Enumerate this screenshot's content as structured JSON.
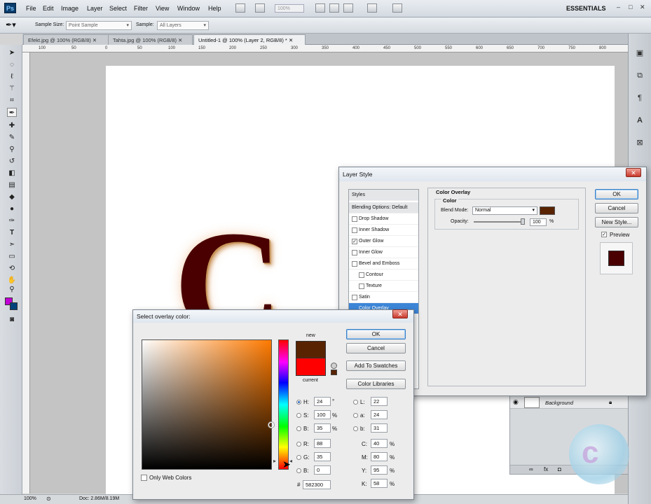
{
  "app": {
    "logo": "Ps",
    "menu": [
      "File",
      "Edit",
      "Image",
      "Layer",
      "Select",
      "Filter",
      "View",
      "Window",
      "Help"
    ],
    "zoom_value": "100%",
    "workspace": "ESSENTIALS",
    "window_controls": [
      "–",
      "□",
      "✕"
    ]
  },
  "options_bar": {
    "sample_size_label": "Sample Size:",
    "sample_size_value": "Point Sample",
    "sample_label": "Sample:",
    "sample_value": "All Layers"
  },
  "tabs": [
    {
      "label": "Efekt.jpg @ 100% (RGB/8)",
      "close": "✕"
    },
    {
      "label": "Tahta.jpg @ 100% (RGB/8)",
      "close": "✕"
    },
    {
      "label": "Untitled-1 @ 100% (Layer 2, RGB/8) *",
      "close": "✕"
    }
  ],
  "ruler_ticks": [
    "100",
    "50",
    "0",
    "50",
    "100",
    "150",
    "200",
    "250",
    "300",
    "350",
    "400",
    "450",
    "500",
    "550",
    "600",
    "650",
    "700",
    "750",
    "800"
  ],
  "canvas": {
    "letter": "C"
  },
  "status": {
    "zoom": "100%",
    "doc": "Doc: 2.86M/8.19M"
  },
  "layers": {
    "name": "Background"
  },
  "layer_style": {
    "title": "Layer Style",
    "close": "✕",
    "styles_header": "Styles",
    "blending": "Blending Options: Default",
    "items": [
      {
        "label": "Drop Shadow",
        "checked": ""
      },
      {
        "label": "Inner Shadow",
        "checked": ""
      },
      {
        "label": "Outer Glow",
        "checked": "✓"
      },
      {
        "label": "Inner Glow",
        "checked": ""
      },
      {
        "label": "Bevel and Emboss",
        "checked": ""
      },
      {
        "label": "Contour",
        "checked": ""
      },
      {
        "label": "Texture",
        "checked": ""
      },
      {
        "label": "Satin",
        "checked": ""
      },
      {
        "label": "Color Overlay",
        "checked": "✓"
      }
    ],
    "section_title": "Color Overlay",
    "group_title": "Color",
    "blend_mode_label": "Blend Mode:",
    "blend_mode_value": "Normal",
    "opacity_label": "Opacity:",
    "opacity_value": "100",
    "opacity_unit": "%",
    "ok": "OK",
    "cancel": "Cancel",
    "new_style": "New Style...",
    "preview_label": "Preview",
    "preview_checked": "✓",
    "overlay_color": "#582300"
  },
  "color_picker": {
    "title": "Select overlay color:",
    "close": "✕",
    "ok": "OK",
    "cancel": "Cancel",
    "add_to_swatches": "Add To Swatches",
    "color_libraries": "Color Libraries",
    "new_label": "new",
    "current_label": "current",
    "new_color": "#582300",
    "current_color": "#ff0000",
    "hsb": [
      {
        "label": "H:",
        "value": "24",
        "unit": "°"
      },
      {
        "label": "S:",
        "value": "100",
        "unit": "%"
      },
      {
        "label": "B:",
        "value": "35",
        "unit": "%"
      }
    ],
    "rgb": [
      {
        "label": "R:",
        "value": "88"
      },
      {
        "label": "G:",
        "value": "35"
      },
      {
        "label": "B:",
        "value": "0"
      }
    ],
    "lab": [
      {
        "label": "L:",
        "value": "22"
      },
      {
        "label": "a:",
        "value": "24"
      },
      {
        "label": "b:",
        "value": "31"
      }
    ],
    "cmyk": [
      {
        "label": "C:",
        "value": "40",
        "unit": "%"
      },
      {
        "label": "M:",
        "value": "80",
        "unit": "%"
      },
      {
        "label": "Y:",
        "value": "95",
        "unit": "%"
      },
      {
        "label": "K:",
        "value": "58",
        "unit": "%"
      }
    ],
    "only_web_colors": "Only Web Colors",
    "hex_label": "#",
    "hex_value": "582300"
  }
}
